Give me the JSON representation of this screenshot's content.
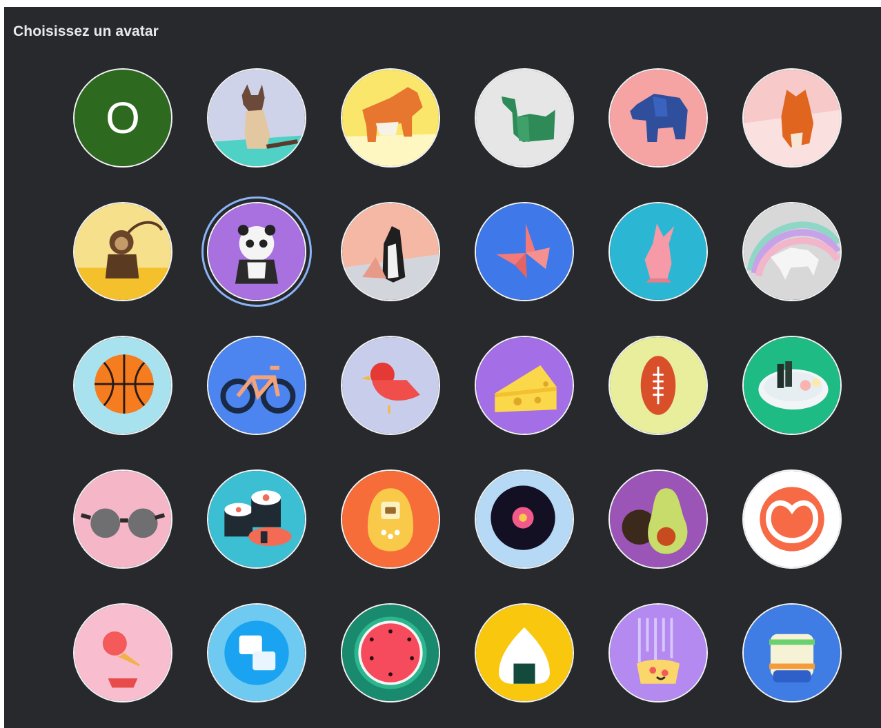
{
  "dialog": {
    "title": "Choisissez un avatar"
  },
  "avatars": [
    {
      "label": "O",
      "name": "letter-avatar",
      "bg": "#2d6a1f"
    },
    {
      "name": "origami-cat",
      "bg": "#cfd3ea"
    },
    {
      "name": "origami-corgi",
      "bg": "#f9e66a"
    },
    {
      "name": "origami-dinosaur",
      "bg": "#e6e6e6"
    },
    {
      "name": "origami-elephant",
      "bg": "#f6a3a3"
    },
    {
      "name": "origami-fox",
      "bg": "#f7c9c9"
    },
    {
      "name": "origami-monkey",
      "bg": "#f7e08c"
    },
    {
      "name": "origami-panda",
      "bg": "#a970e0",
      "selected": true
    },
    {
      "name": "origami-penguin",
      "bg": "#f5b8a5"
    },
    {
      "name": "origami-butterfly",
      "bg": "#3f78e8"
    },
    {
      "name": "origami-rabbit",
      "bg": "#2bb7d3"
    },
    {
      "name": "origami-unicorn",
      "bg": "#d8d8d8"
    },
    {
      "name": "basketball",
      "bg": "#a7e2ee"
    },
    {
      "name": "bicycle",
      "bg": "#4c85ef"
    },
    {
      "name": "bird",
      "bg": "#c7cdeb"
    },
    {
      "name": "cheese",
      "bg": "#a36ee6"
    },
    {
      "name": "football",
      "bg": "#e8ee9b"
    },
    {
      "name": "ramen",
      "bg": "#1fbb85"
    },
    {
      "name": "sunglasses",
      "bg": "#f5b7c8"
    },
    {
      "name": "sushi",
      "bg": "#3cbfd3"
    },
    {
      "name": "tamagotchi",
      "bg": "#f66d3a"
    },
    {
      "name": "vinyl-record",
      "bg": "#b6d9f5"
    },
    {
      "name": "avocado",
      "bg": "#9b55b6"
    },
    {
      "name": "pill-logo",
      "bg": "#ffffff"
    },
    {
      "name": "ice-cream",
      "bg": "#f8bed0"
    },
    {
      "name": "ice-cubes",
      "bg": "#6fcaf2"
    },
    {
      "name": "watermelon",
      "bg": "#1a8a6e"
    },
    {
      "name": "onigiri",
      "bg": "#f9c80e"
    },
    {
      "name": "pizza",
      "bg": "#b48af0"
    },
    {
      "name": "sandwich",
      "bg": "#3f7de4"
    }
  ]
}
